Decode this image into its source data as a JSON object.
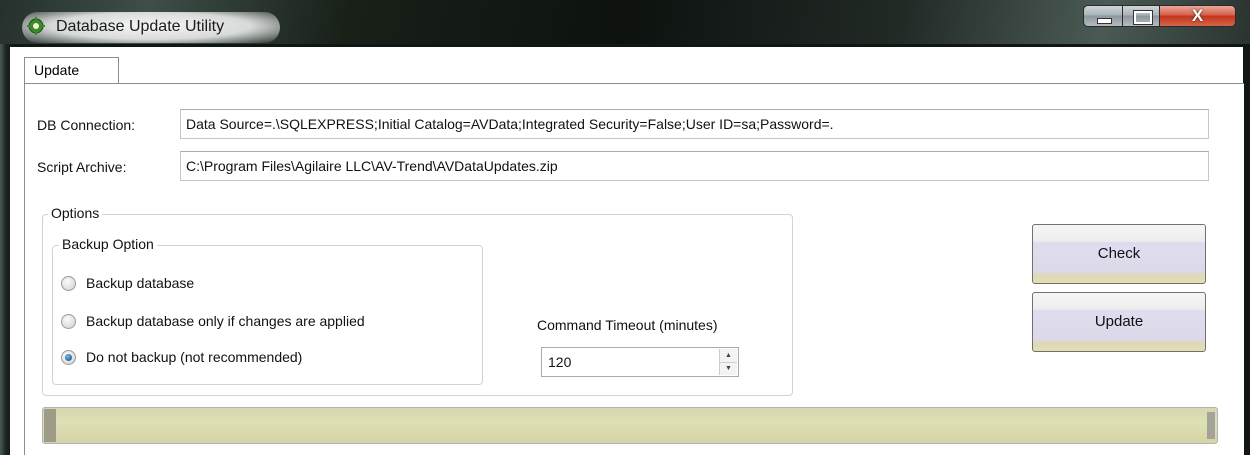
{
  "window": {
    "title": "Database Update Utility",
    "close_glyph": "X",
    "icon": "gear-icon"
  },
  "tabs": [
    {
      "label": "Update",
      "selected": true
    }
  ],
  "form": {
    "db_connection_label": "DB Connection:",
    "db_connection_value": "Data Source=.\\SQLEXPRESS;Initial Catalog=AVData;Integrated Security=False;User ID=sa;Password=.",
    "script_archive_label": "Script Archive:",
    "script_archive_value": "C:\\Program Files\\Agilaire LLC\\AV-Trend\\AVDataUpdates.zip"
  },
  "options": {
    "title": "Options",
    "backup": {
      "title": "Backup Option",
      "choices": [
        {
          "label": "Backup database",
          "checked": false
        },
        {
          "label": "Backup database only if changes are applied",
          "checked": false
        },
        {
          "label": "Do not backup (not recommended)",
          "checked": true
        }
      ]
    },
    "timeout_label": "Command Timeout (minutes)",
    "timeout_value": "120"
  },
  "buttons": {
    "check": "Check",
    "update": "Update"
  },
  "progress": {
    "value": 0.01
  },
  "colors": {
    "accent_radio": "#2a6fb0",
    "close_button": "#c2341c",
    "progress_track": "#e0e0b6"
  }
}
